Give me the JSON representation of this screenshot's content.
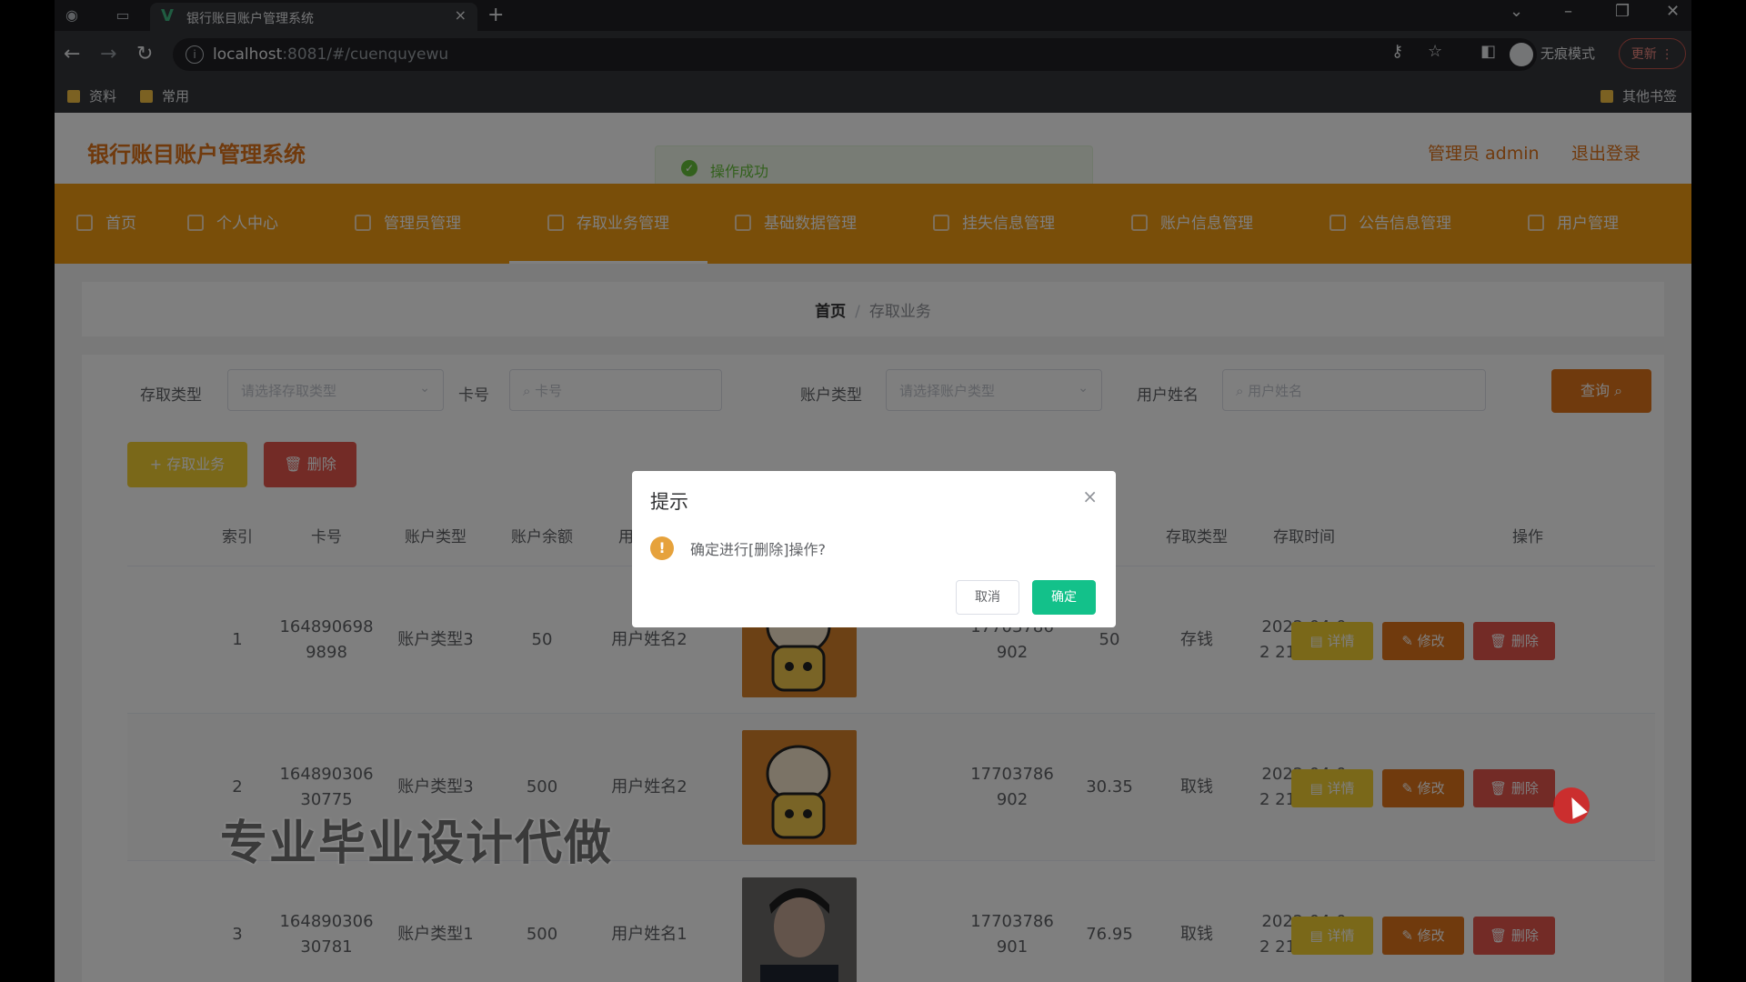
{
  "browser": {
    "tab_title": "银行账目账户管理系统",
    "tab_close": "×",
    "new_tab": "+",
    "url_host": "localhost",
    "url_rest": ":8081/#/cuenquyewu",
    "incognito_label": "无痕模式",
    "update_label": "更新",
    "bookmarks": [
      "资料",
      "常用"
    ],
    "other_bookmarks": "其他书签"
  },
  "header": {
    "app_title": "银行账目账户管理系统",
    "admin_label": "管理员 admin",
    "logout_label": "退出登录",
    "toast_message": "操作成功"
  },
  "nav": {
    "items": [
      "首页",
      "个人中心",
      "管理员管理",
      "存取业务管理",
      "基础数据管理",
      "挂失信息管理",
      "账户信息管理",
      "公告信息管理",
      "用户管理"
    ],
    "active_index": 3
  },
  "breadcrumb": {
    "home": "首页",
    "separator": "/",
    "current": "存取业务"
  },
  "search": {
    "fields": [
      {
        "label": "存取类型",
        "placeholder": "请选择存取类型"
      },
      {
        "label": "卡号",
        "placeholder": "卡号"
      },
      {
        "label": "账户类型",
        "placeholder": "请选择账户类型"
      },
      {
        "label": "用户姓名",
        "placeholder": "用户姓名"
      }
    ],
    "button_label": "查询"
  },
  "toolbar": {
    "add_label": "+ 存取业务",
    "delete_label": "删除"
  },
  "table": {
    "headers": [
      "索引",
      "卡号",
      "账户类型",
      "账户余额",
      "用户姓名",
      "存取类型",
      "存取时间",
      "操作"
    ],
    "actions": {
      "detail": "详情",
      "edit": "修改",
      "delete": "删除"
    },
    "rows": [
      {
        "index": "1",
        "card_line1": "164890698",
        "card_line2": "9898",
        "account_type": "账户类型3",
        "balance": "50",
        "user_name": "用户姓名2",
        "phone_line1": "17703786",
        "phone_line2": "902",
        "amount": "50",
        "txn_type": "存钱",
        "time_line1": "2022-04-0",
        "time_line2": "2 21:43:34"
      },
      {
        "index": "2",
        "card_line1": "164890306",
        "card_line2": "30775",
        "account_type": "账户类型3",
        "balance": "500",
        "user_name": "用户姓名2",
        "phone_line1": "17703786",
        "phone_line2": "902",
        "amount": "30.35",
        "txn_type": "取钱",
        "time_line1": "2022-04-0",
        "time_line2": "2 21:42:49"
      },
      {
        "index": "3",
        "card_line1": "164890306",
        "card_line2": "30781",
        "account_type": "账户类型1",
        "balance": "500",
        "user_name": "用户姓名1",
        "phone_line1": "17703786",
        "phone_line2": "901",
        "amount": "76.95",
        "txn_type": "取钱",
        "time_line1": "2022-04-0",
        "time_line2": "2 21:41:48"
      }
    ]
  },
  "dialog": {
    "title": "提示",
    "message": "确定进行[删除]操作?",
    "cancel_label": "取消",
    "confirm_label": "确定"
  },
  "watermark": "专业毕业设计代做",
  "colors": {
    "nav_bg": "#f39c12",
    "accent": "#e0741a",
    "confirm": "#13c18a",
    "warning": "#e6a23c"
  }
}
